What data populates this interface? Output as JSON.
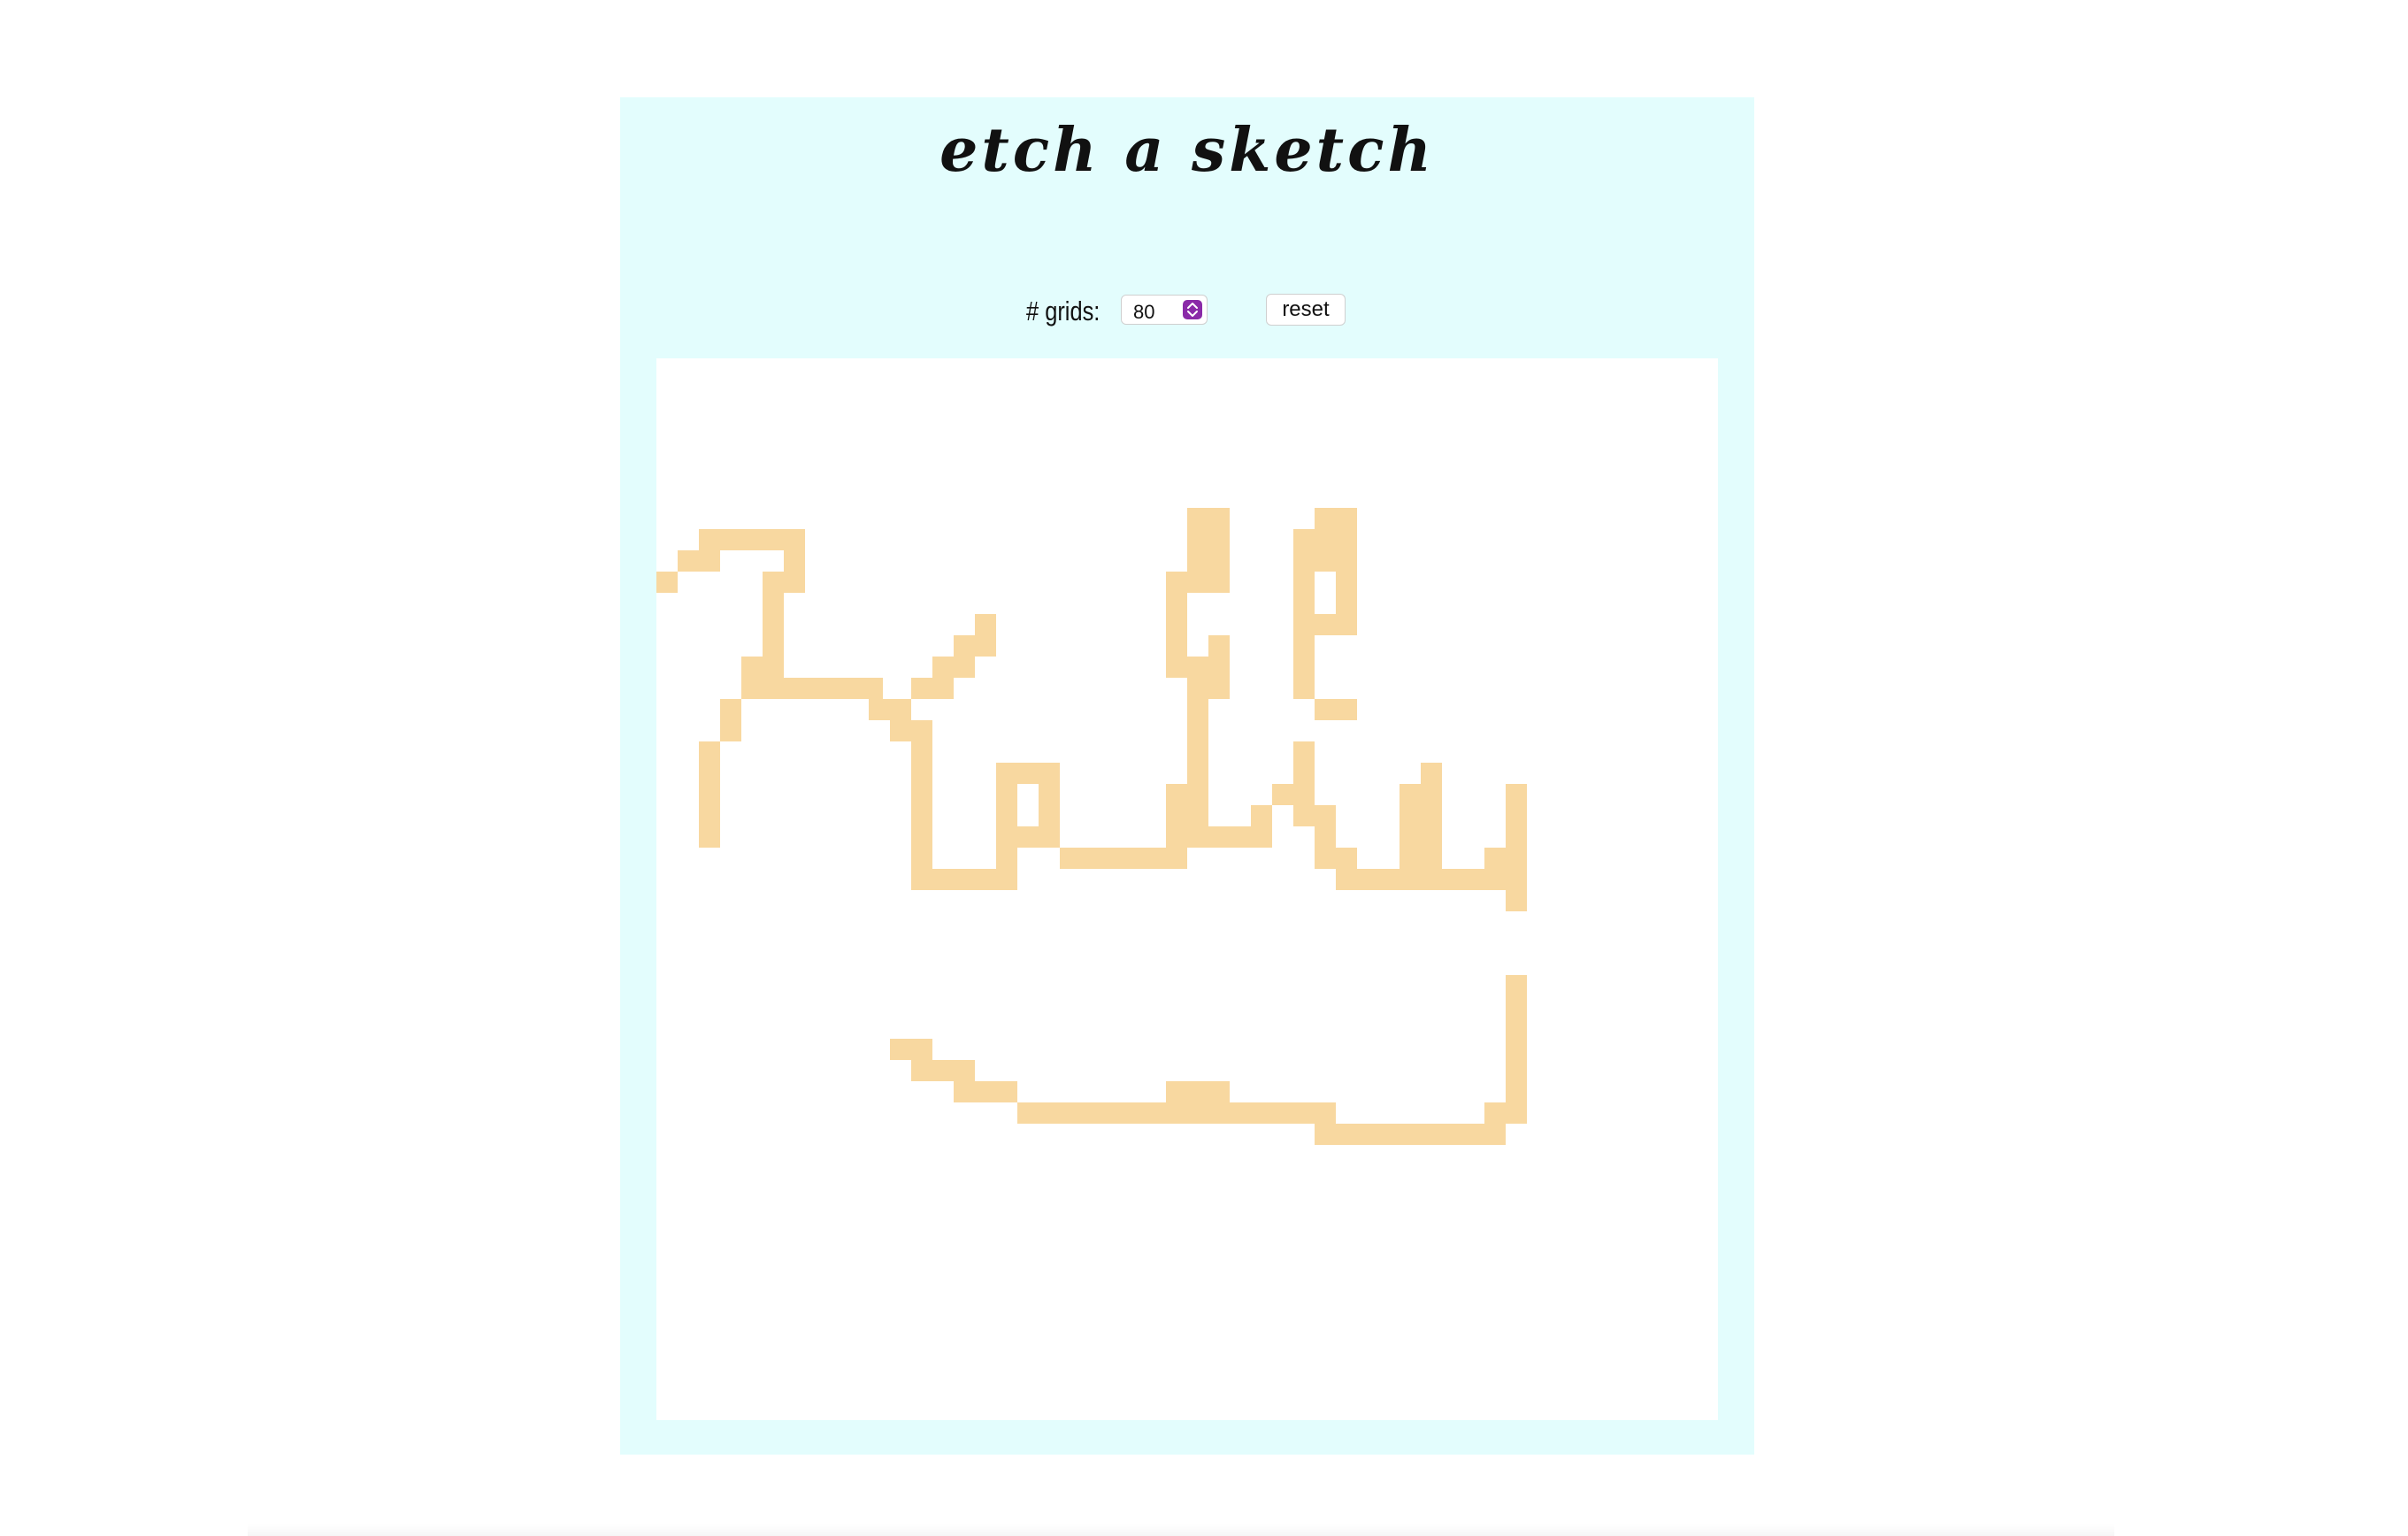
{
  "app": {
    "title": "etch a sketch"
  },
  "controls": {
    "grids_label": "# grids:",
    "grids_value": "80",
    "reset_label": "reset"
  },
  "colors": {
    "panel_background": "#e3fdfd",
    "canvas_background": "#ffffff",
    "paint": "#f8d8a0",
    "select_arrow_accent": "#8a2aa8"
  },
  "icons": {
    "select_arrows": "up-down-chevron-icon"
  }
}
